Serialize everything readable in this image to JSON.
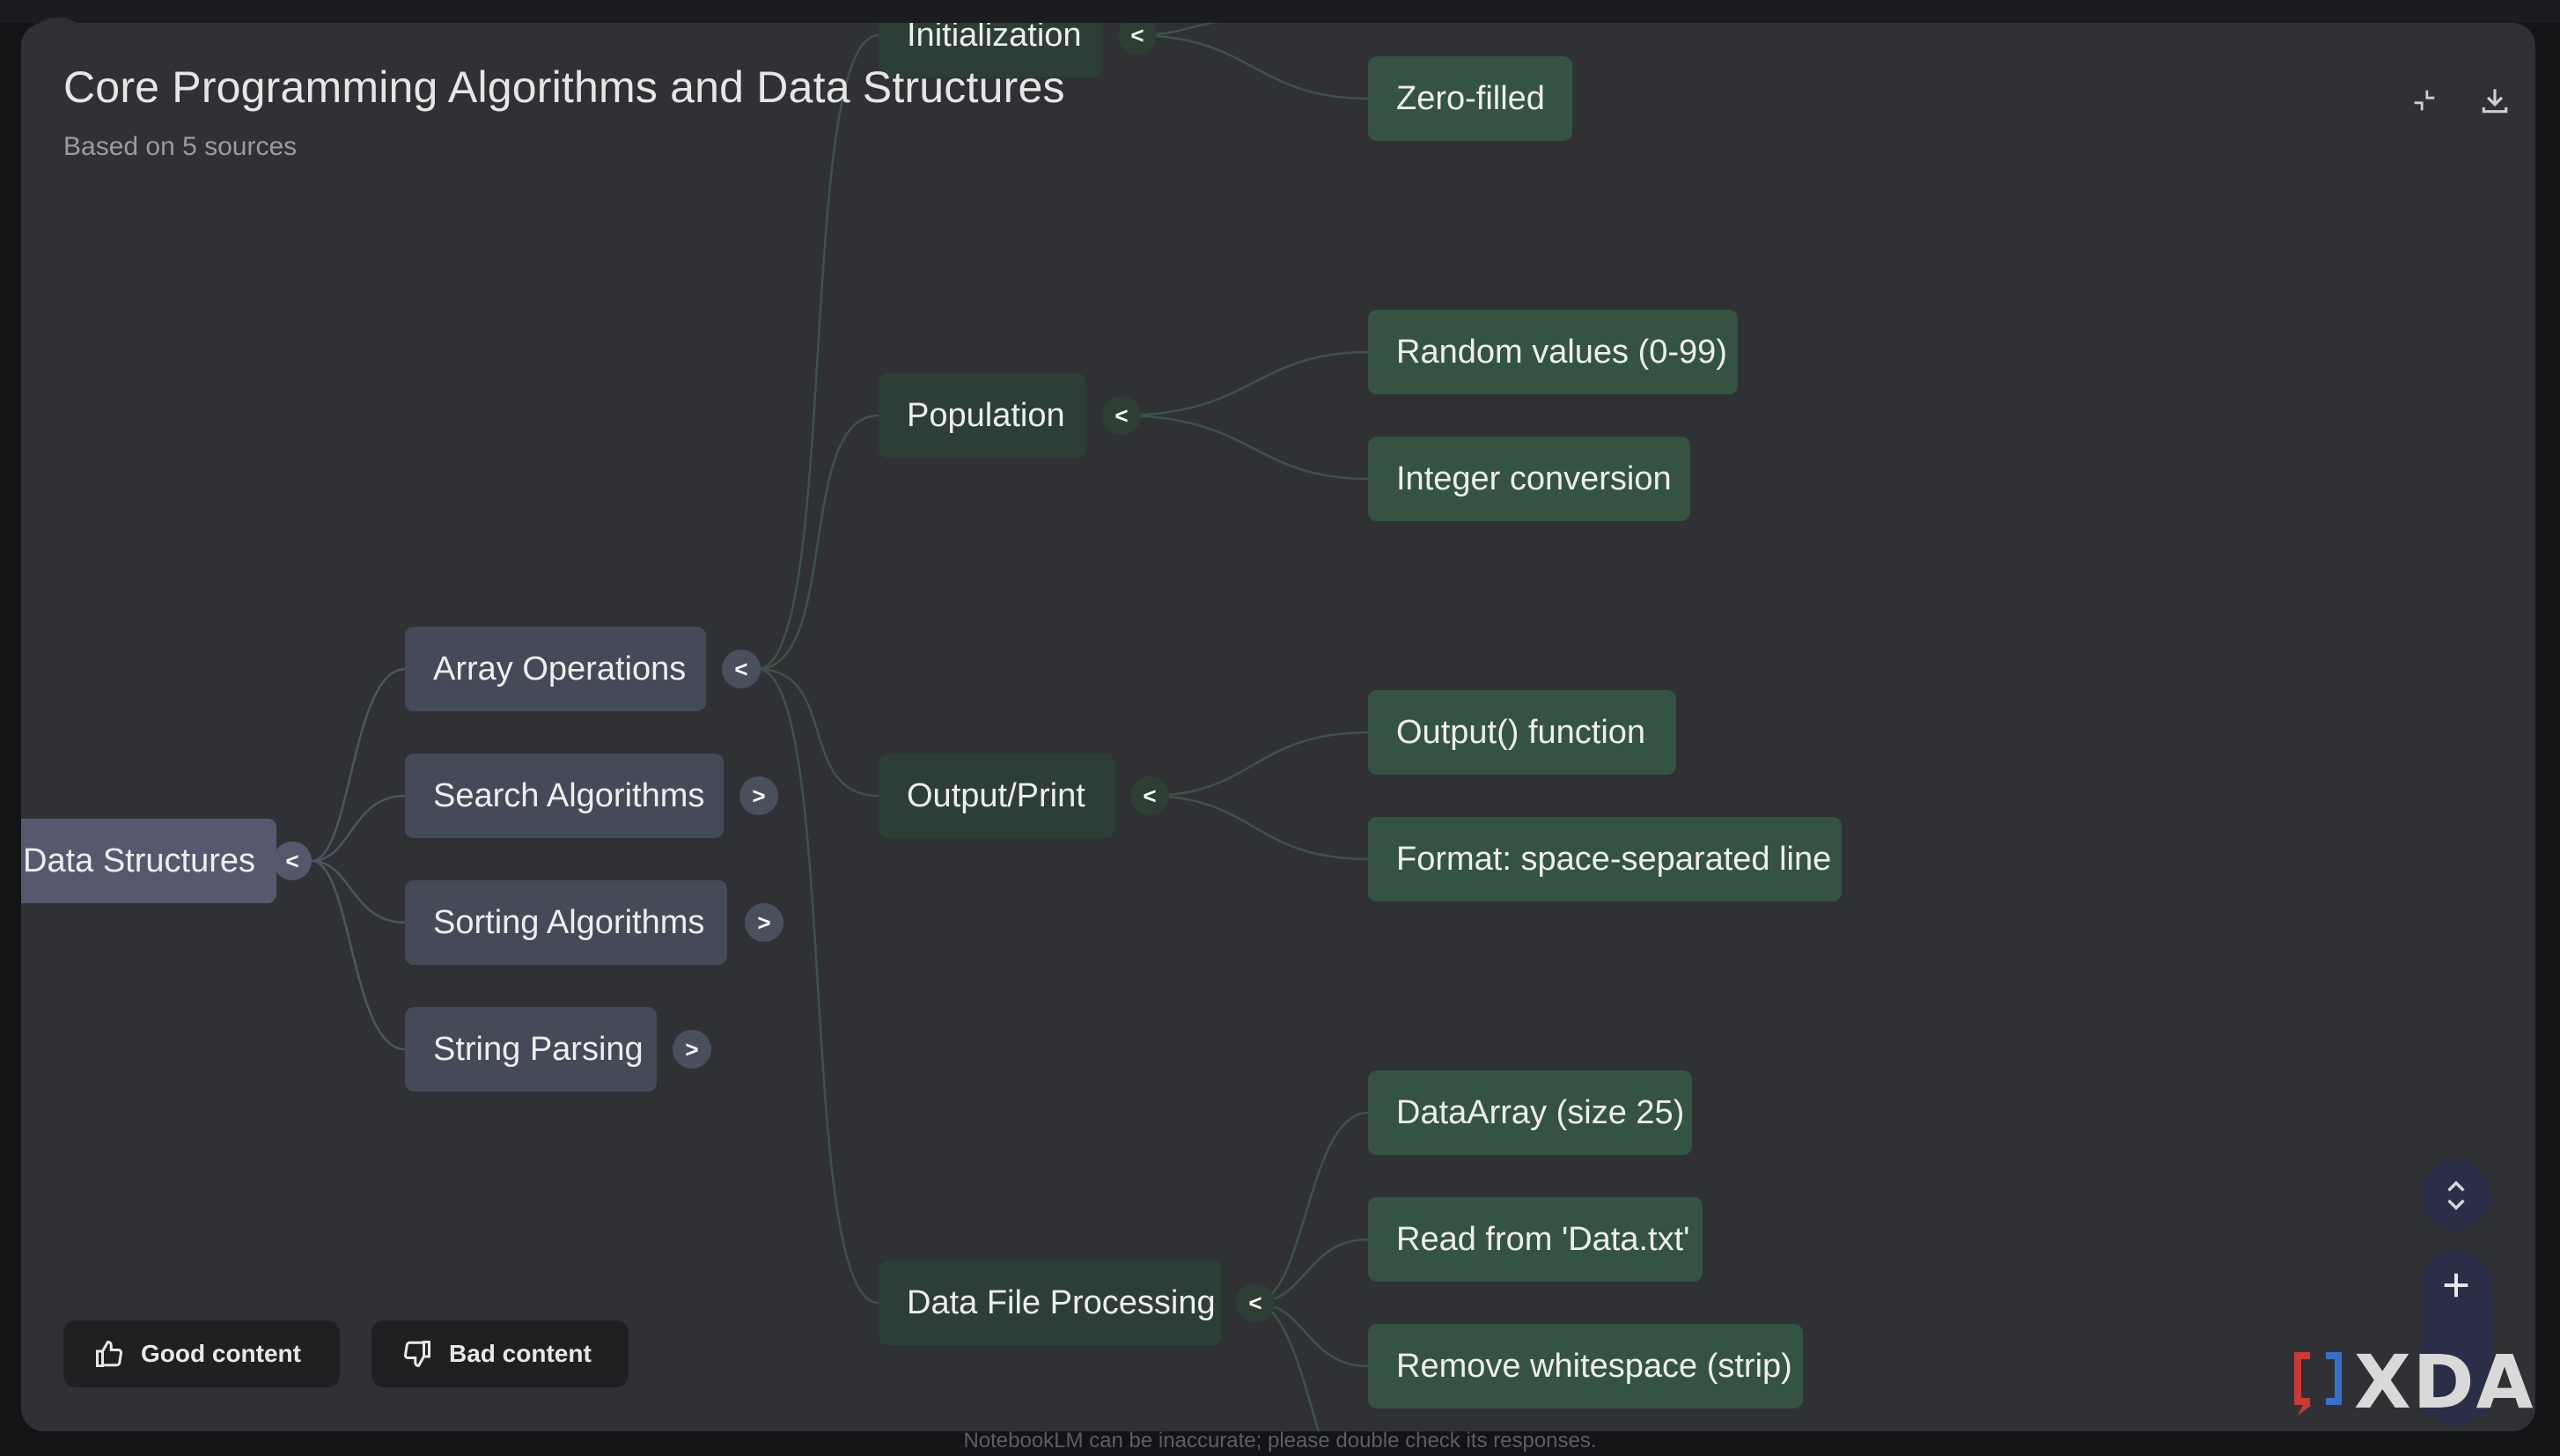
{
  "header": {
    "title": "Core Programming Algorithms and Data Structures",
    "subtitle": "Based on 5 sources",
    "collapse_icon": "collapse-icon",
    "download_icon": "download-icon"
  },
  "mindmap": {
    "root": {
      "label": "Data Structures",
      "toggle": "<"
    },
    "level1": [
      {
        "label": "Array Operations",
        "toggle": "<"
      },
      {
        "label": "Search Algorithms",
        "toggle": ">"
      },
      {
        "label": "Sorting Algorithms",
        "toggle": ">"
      },
      {
        "label": "String Parsing",
        "toggle": ">"
      }
    ],
    "level2": [
      {
        "label": "Initialization",
        "toggle": "<"
      },
      {
        "label": "Population",
        "toggle": "<"
      },
      {
        "label": "Output/Print",
        "toggle": "<"
      },
      {
        "label": "Data File Processing",
        "toggle": "<"
      }
    ],
    "level3": [
      {
        "label": "Zero-filled"
      },
      {
        "label": "Random values (0-99)"
      },
      {
        "label": "Integer conversion"
      },
      {
        "label": "Output() function"
      },
      {
        "label": "Format: space-separated line"
      },
      {
        "label": "DataArray (size 25)"
      },
      {
        "label": "Read from 'Data.txt'"
      },
      {
        "label": "Remove whitespace (strip)"
      }
    ]
  },
  "feedback": {
    "good_label": "Good content",
    "bad_label": "Bad content"
  },
  "controls": {
    "expand_collapse_icon": "expand-collapse-icon",
    "zoom_in_icon": "plus-icon"
  },
  "disclaimer": "NotebookLM can be inaccurate; please double check its responses.",
  "watermark": {
    "text": "XDA"
  },
  "colors": {
    "panel": "#303135",
    "root_node": "#56596e",
    "level1_node": "#454a58",
    "level2_node": "#2c3e35",
    "level3_node": "#355342"
  }
}
